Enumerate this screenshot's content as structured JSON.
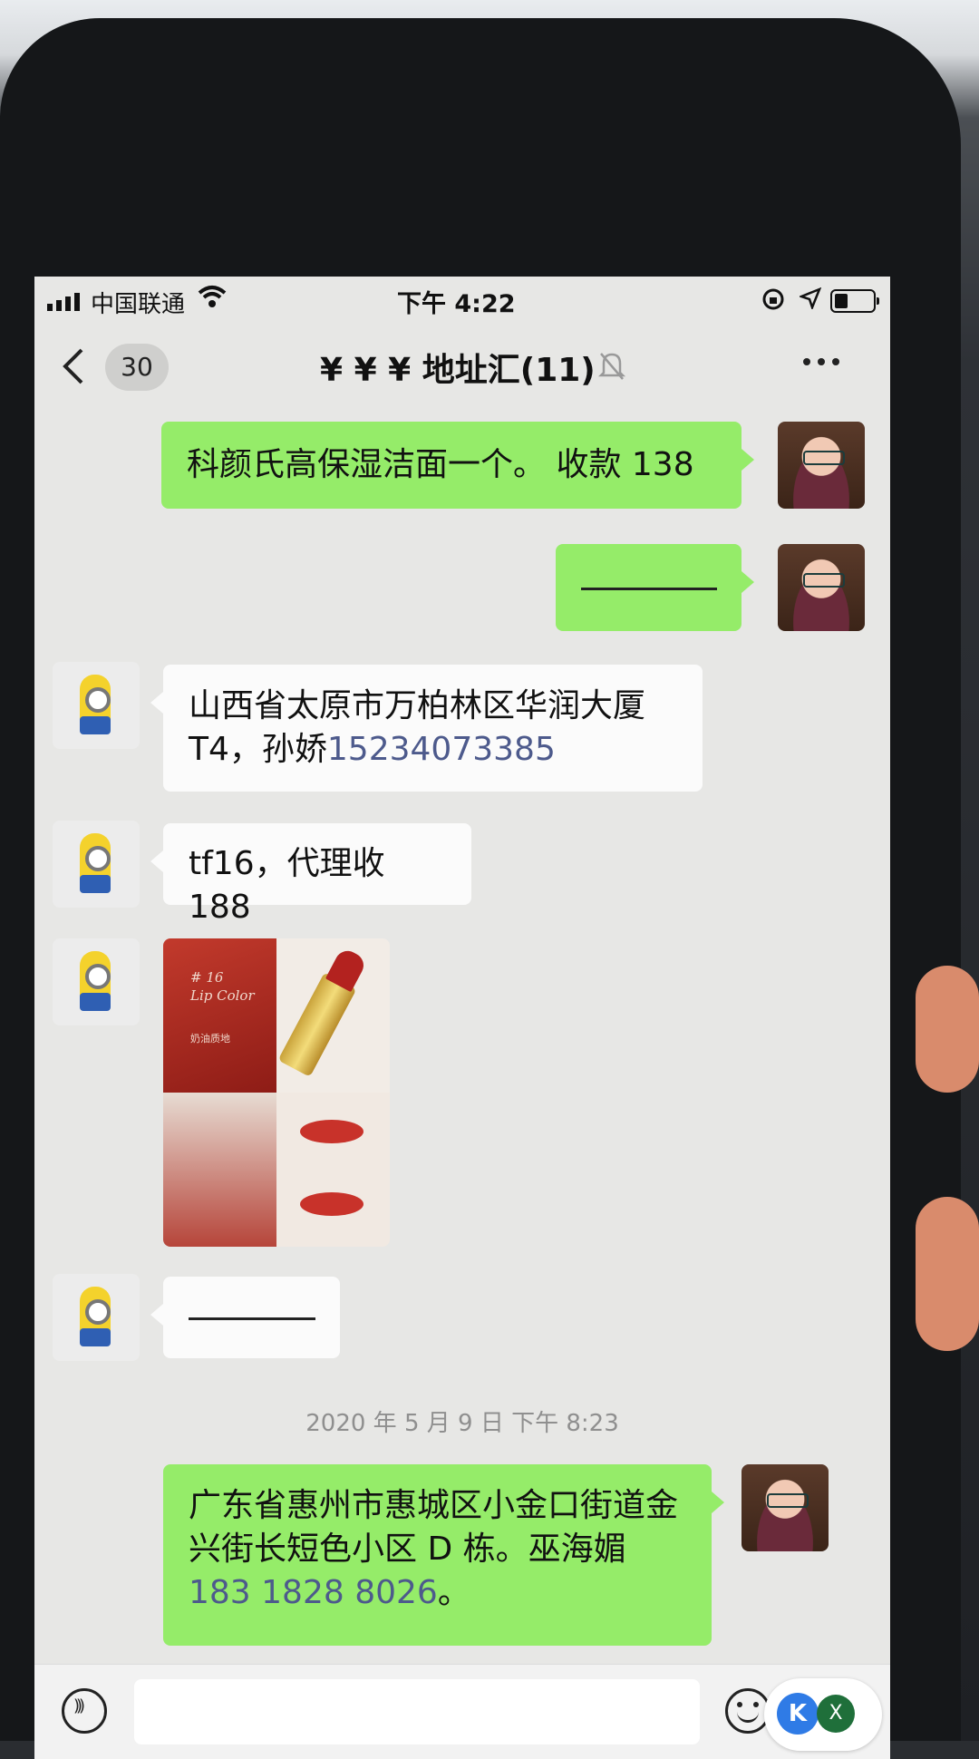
{
  "status_bar": {
    "carrier": "中国联通",
    "time": "下午 4:22",
    "icons": [
      "signal-icon",
      "wifi-icon",
      "rotation-lock-icon",
      "location-icon",
      "battery-icon"
    ]
  },
  "nav": {
    "unread_count": "30",
    "title": "¥ ¥ ¥ 地址汇(11)",
    "icons": [
      "chevron-left-icon",
      "bell-muted-icon",
      "more-icon"
    ]
  },
  "messages": [
    {
      "side": "right",
      "text": "科颜氏高保湿洁面一个。 收款 138"
    },
    {
      "side": "right",
      "text": "———"
    },
    {
      "side": "left",
      "text_part": "山西省太原市万柏林区华润大厦T4，孙娇",
      "phone": "15234073385"
    },
    {
      "side": "left",
      "text": "tf16，代理收 188"
    },
    {
      "side": "left",
      "type": "image",
      "image_text": {
        "code": "# 16",
        "name": "Lip Color",
        "texture": "奶油质地"
      }
    },
    {
      "side": "left",
      "text": "———"
    }
  ],
  "timestamp": "2020 年 5 月 9 日  下午 8:23",
  "last_message": {
    "side": "right",
    "text_part": "广东省惠州市惠城区小金口街道金兴街长短色小区 D 栋。巫海媚",
    "phone": "183 1828 8026",
    "suffix": "。"
  },
  "input_bar": {
    "placeholder": "",
    "float_button": {
      "k": "K",
      "x": "X"
    }
  },
  "colors": {
    "sent_bubble": "#95ec69",
    "received_bubble": "#fbfbfb",
    "link": "#4d5a8c",
    "chat_bg": "#e7e7e5"
  }
}
